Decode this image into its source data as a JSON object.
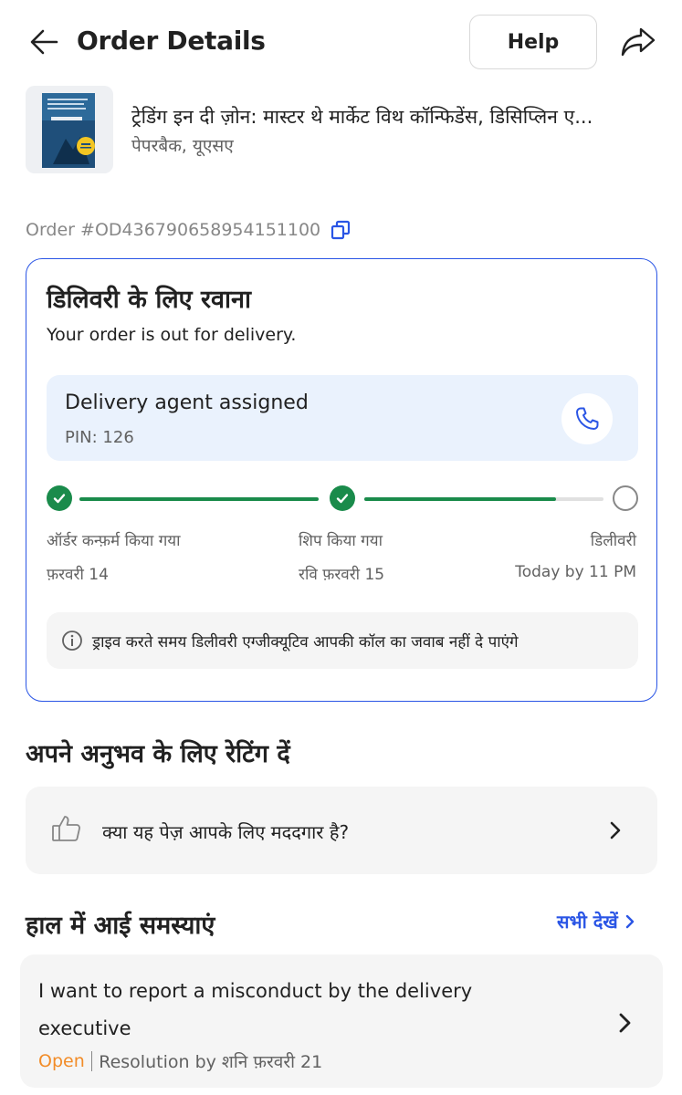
{
  "header": {
    "title": "Order Details",
    "help_label": "Help"
  },
  "product": {
    "title": "ट्रेडिंग इन दी ज़ोन: मास्टर थे मार्केट विथ कॉन्फिडेंस, डिसिप्लिन ए...",
    "subtitle": "पेपरबैक, यूएसए"
  },
  "order": {
    "id_label": "Order #OD436790658954151100"
  },
  "status": {
    "title": "डिलिवरी के लिए रवाना",
    "subtitle": "Your order is out for delivery.",
    "agent": {
      "title": "Delivery agent assigned",
      "pin": "PIN: 126"
    },
    "progress_fraction": 0.8,
    "steps": [
      {
        "label": "ऑर्डर कन्फ़र्म किया गया",
        "date": "फ़रवरी 14",
        "done": true
      },
      {
        "label": "शिप किया गया",
        "date": "रवि फ़रवरी 15",
        "done": true
      },
      {
        "label": "डिलीवरी",
        "date": "Today by 11 PM",
        "done": false
      }
    ],
    "note": "ड्राइव करते समय डिलीवरी एग्जीक्यूटिव आपकी कॉल का जवाब नहीं दे पाएंगे"
  },
  "rating": {
    "section_title": "अपने अनुभव के लिए रेटिंग दें",
    "prompt": "क्या यह पेज़ आपके लिए मददगार है?"
  },
  "issues": {
    "section_title": "हाल में आई समस्याएं",
    "see_all": "सभी देखें",
    "items": [
      {
        "text": "I want to report a misconduct by the delivery executive",
        "status": "Open",
        "resolution": "Resolution by शनि फ़रवरी 21"
      }
    ]
  },
  "colors": {
    "accent": "#2a55e5",
    "success": "#1a8b4b",
    "open_status": "#f28c28",
    "agent_bg": "#eaf2fd",
    "card_bg": "#f5f5f5"
  },
  "icons": [
    "back-arrow-icon",
    "share-icon",
    "copy-icon",
    "phone-icon",
    "check-icon",
    "info-icon",
    "thumbs-up-icon",
    "chevron-right-icon"
  ]
}
